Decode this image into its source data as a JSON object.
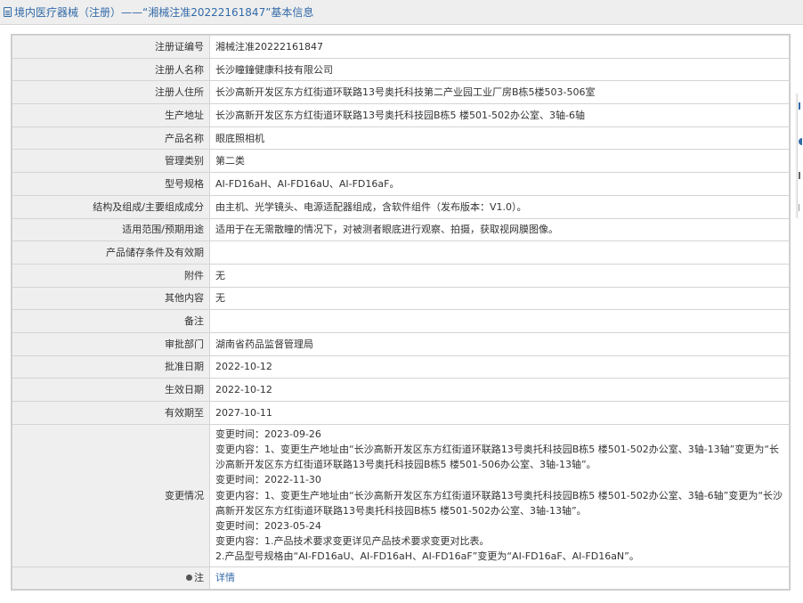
{
  "header": {
    "title": "境内医疗器械（注册）——“湘械注准20222161847”基本信息"
  },
  "rows": [
    {
      "label": "注册证编号",
      "value": "湘械注准20222161847"
    },
    {
      "label": "注册人名称",
      "value": "长沙瞳鐘健康科技有限公司"
    },
    {
      "label": "注册人住所",
      "value": "长沙高新开发区东方红街道环联路13号奥托科技第二产业园工业厂房B栋5楼503-506室"
    },
    {
      "label": "生产地址",
      "value": "长沙高新开发区东方红街道环联路13号奥托科技园B栋5 楼501-502办公室、3轴-6轴"
    },
    {
      "label": "产品名称",
      "value": "眼底照相机"
    },
    {
      "label": "管理类别",
      "value": "第二类"
    },
    {
      "label": "型号规格",
      "value": "AI-FD16aH、AI-FD16aU、AI-FD16aF。"
    },
    {
      "label": "结构及组成/主要组成成分",
      "value": "由主机、光学镜头、电源适配器组成，含软件组件（发布版本：V1.0）。"
    },
    {
      "label": "适用范围/预期用途",
      "value": "适用于在无需散瞳的情况下，对被测者眼底进行观察、拍摄，获取视网膜图像。"
    },
    {
      "label": "产品储存条件及有效期",
      "value": ""
    },
    {
      "label": "附件",
      "value": "无"
    },
    {
      "label": "其他内容",
      "value": "无"
    },
    {
      "label": "备注",
      "value": ""
    },
    {
      "label": "审批部门",
      "value": "湖南省药品监督管理局"
    },
    {
      "label": "批准日期",
      "value": "2022-10-12"
    },
    {
      "label": "生效日期",
      "value": "2022-10-12"
    },
    {
      "label": "有效期至",
      "value": "2027-10-11"
    }
  ],
  "changes": {
    "label": "变更情况",
    "lines": [
      "变更时间：2023-09-26",
      "变更内容：1、变更生产地址由“长沙高新开发区东方红街道环联路13号奥托科技园B栋5 楼501-502办公室、3轴-13轴”变更为“长",
      "沙高新开发区东方红街道环联路13号奥托科技园B栋5 楼501-506办公室、3轴-13轴”。",
      "变更时间：2022-11-30",
      "变更内容：1、变更生产地址由“长沙高新开发区东方红街道环联路13号奥托科技园B栋5 楼501-502办公室、3轴-6轴”变更为“长沙",
      "高新开发区东方红街道环联路13号奥托科技园B栋5 楼501-502办公室、3轴-13轴”。",
      "变更时间：2023-05-24",
      "变更内容：1.产品技术要求变更详见产品技术要求变更对比表。",
      "2.产品型号规格由“AI-FD16aU、AI-FD16aH、AI-FD16aF”变更为“AI-FD16aF、AI-FD16aN”。"
    ]
  },
  "note": {
    "label": "注",
    "link": "详情"
  },
  "colors": {
    "accent": "#326aa8",
    "label_bg": "#efefef",
    "border": "#d4d4d4"
  }
}
